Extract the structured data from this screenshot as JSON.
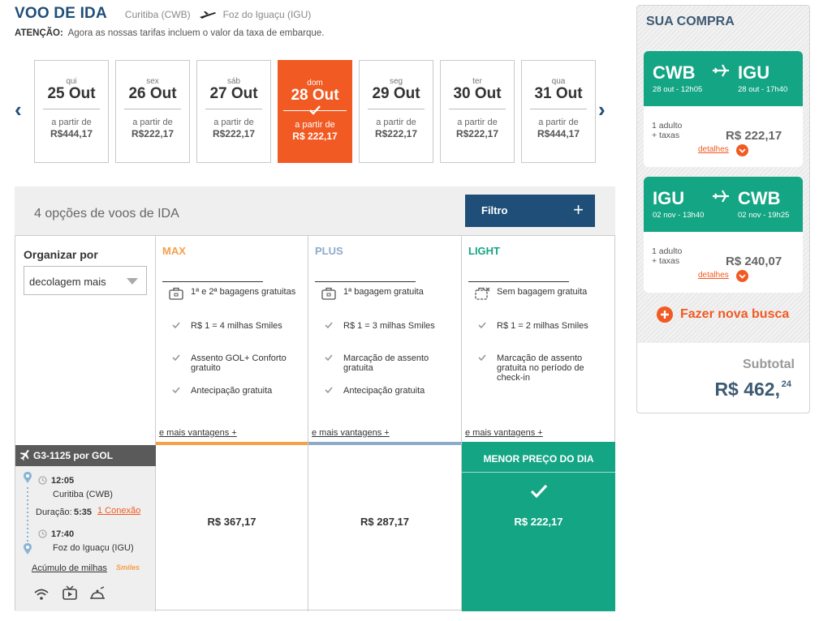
{
  "header": {
    "title": "VOO DE IDA",
    "origin": "Curitiba (CWB)",
    "destination": "Foz do Iguaçu (IGU)",
    "notice_bold": "ATENÇÃO:",
    "notice_text": "Agora as nossas tarifas incluem o valor da taxa de embarque."
  },
  "dates": [
    {
      "dow": "qui",
      "date": "25 Out",
      "from": "a partir de",
      "price": "R$444,17"
    },
    {
      "dow": "sex",
      "date": "26 Out",
      "from": "a partir de",
      "price": "R$222,17"
    },
    {
      "dow": "sáb",
      "date": "27 Out",
      "from": "a partir de",
      "price": "R$222,17"
    },
    {
      "dow": "dom",
      "date": "28 Out",
      "from": "a partir de",
      "price": "R$ 222,17",
      "selected": true
    },
    {
      "dow": "seg",
      "date": "29 Out",
      "from": "a partir de",
      "price": "R$222,17"
    },
    {
      "dow": "ter",
      "date": "30 Out",
      "from": "a partir de",
      "price": "R$222,17"
    },
    {
      "dow": "qua",
      "date": "31 Out",
      "from": "a partir de",
      "price": "R$444,17"
    }
  ],
  "options": {
    "count_text": "4 opções de voos de IDA",
    "filter_label": "Filtro",
    "filter_plus": "+"
  },
  "sort": {
    "label": "Organizar por",
    "value": "decolagem mais"
  },
  "fares": [
    {
      "name": "MAX",
      "color": "#f5a04a",
      "features": [
        {
          "icon": "baggage-icon",
          "text": "1ª e 2ª bagagens gratuitas"
        },
        {
          "icon": "check-icon",
          "text": "R$ 1 = 4 milhas Smiles"
        },
        {
          "icon": "check-icon",
          "text": "Assento GOL+ Conforto gratuito"
        },
        {
          "icon": "check-icon",
          "text": "Antecipação gratuita"
        }
      ],
      "more": "e mais vantagens +",
      "price": "R$ 367,17"
    },
    {
      "name": "PLUS",
      "color": "#8eaac9",
      "features": [
        {
          "icon": "baggage-icon",
          "text": "1ª bagagem gratuita"
        },
        {
          "icon": "check-icon",
          "text": "R$ 1 = 3 milhas Smiles"
        },
        {
          "icon": "check-icon",
          "text": "Marcação de assento gratuita"
        },
        {
          "icon": "check-icon",
          "text": "Antecipação gratuita"
        }
      ],
      "more": "e mais vantagens +",
      "price": "R$ 287,17"
    },
    {
      "name": "LIGHT",
      "color": "#14a584",
      "features": [
        {
          "icon": "no-baggage-icon",
          "text": "Sem bagagem gratuita"
        },
        {
          "icon": "check-icon",
          "text": "R$ 1 = 2 milhas Smiles"
        },
        {
          "icon": "check-icon",
          "text": "Marcação de assento gratuita no período de check-in"
        }
      ],
      "more": "e mais vantagens +",
      "price": "R$ 222,17",
      "best_label": "MENOR  PREÇO DO DIA"
    }
  ],
  "flight": {
    "code": "G3-1125 por  GOL",
    "dep_time": "12:05",
    "dep_city": "Curitiba (CWB)",
    "duration_label": "Duração:",
    "duration": "5:35",
    "connections": "1 Conexão",
    "arr_time": "17:40",
    "arr_city": "Foz do Iguaçu (IGU)",
    "miles": "Acúmulo de milhas",
    "smiles": "Smiles"
  },
  "cart": {
    "title": "SUA COMPRA",
    "legs": [
      {
        "from": "CWB",
        "to": "IGU",
        "dep": "28 out - 12h05",
        "arr": "28 out - 17h40",
        "pax": "1 adulto",
        "tax": "+ taxas",
        "price": "R$ 222,17",
        "details": "detalhes"
      },
      {
        "from": "IGU",
        "to": "CWB",
        "dep": "02 nov - 13h40",
        "arr": "02 nov - 19h25",
        "pax": "1 adulto",
        "tax": "+ taxas",
        "price": "R$ 240,07",
        "details": "detalhes"
      }
    ],
    "new_search": "Fazer nova busca",
    "subtotal_label": "Subtotal",
    "subtotal_value": "R$ 462,",
    "subtotal_cents": "24"
  },
  "colors": {
    "brand_orange": "#f15a22",
    "navy": "#1f4e79",
    "green": "#14a584"
  }
}
